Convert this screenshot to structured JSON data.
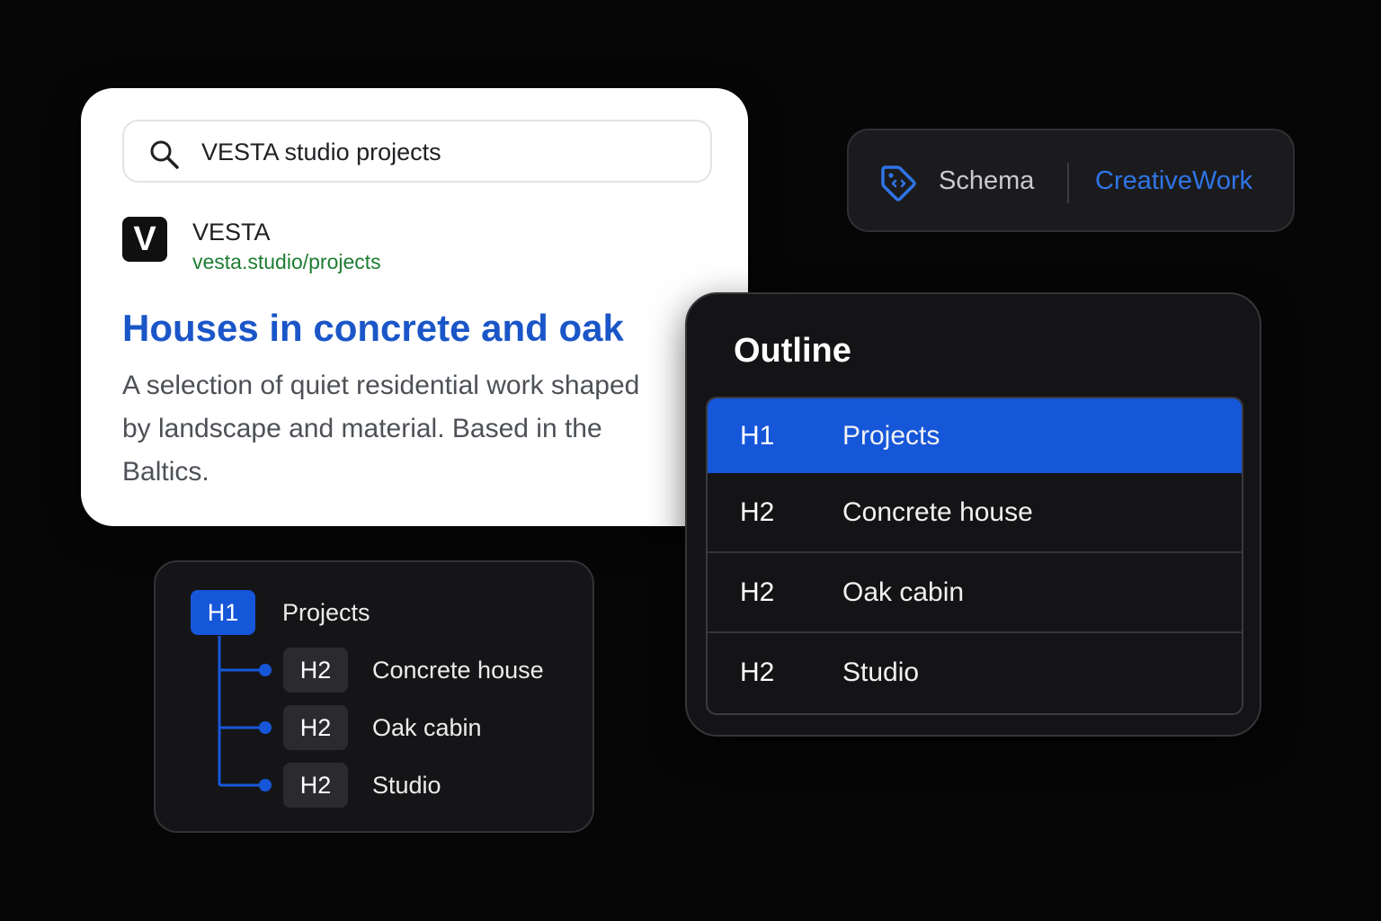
{
  "search_result": {
    "query": "VESTA studio projects",
    "site_logo_letter": "V",
    "site_name": "VESTA",
    "site_url": "vesta.studio/projects",
    "title": "Houses in concrete and oak",
    "description": "A selection of quiet residential work shaped by landscape and material. Based in the Baltics."
  },
  "schema": {
    "icon": "tag-icon",
    "label": "Schema",
    "type": "CreativeWork"
  },
  "outline": {
    "title": "Outline",
    "rows": [
      {
        "level": "H1",
        "text": "Projects",
        "active": true
      },
      {
        "level": "H2",
        "text": "Concrete house",
        "active": false
      },
      {
        "level": "H2",
        "text": "Oak cabin",
        "active": false
      },
      {
        "level": "H2",
        "text": "Studio",
        "active": false
      }
    ]
  },
  "tree": {
    "root": {
      "level": "H1",
      "text": "Projects"
    },
    "children": [
      {
        "level": "H2",
        "text": "Concrete house"
      },
      {
        "level": "H2",
        "text": "Oak cabin"
      },
      {
        "level": "H2",
        "text": "Studio"
      }
    ]
  },
  "colors": {
    "accent": "#1656d9",
    "link": "#1a56c8",
    "url": "#1e7d32",
    "background": "#060606"
  }
}
